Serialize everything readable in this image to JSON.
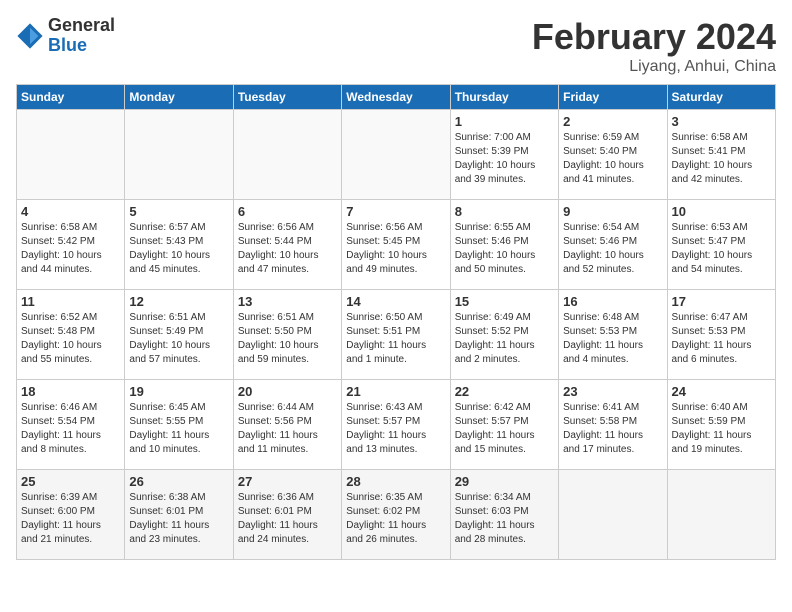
{
  "header": {
    "logo_general": "General",
    "logo_blue": "Blue",
    "title": "February 2024",
    "subtitle": "Liyang, Anhui, China"
  },
  "weekdays": [
    "Sunday",
    "Monday",
    "Tuesday",
    "Wednesday",
    "Thursday",
    "Friday",
    "Saturday"
  ],
  "weeks": [
    [
      {
        "day": "",
        "info": ""
      },
      {
        "day": "",
        "info": ""
      },
      {
        "day": "",
        "info": ""
      },
      {
        "day": "",
        "info": ""
      },
      {
        "day": "1",
        "info": "Sunrise: 7:00 AM\nSunset: 5:39 PM\nDaylight: 10 hours\nand 39 minutes."
      },
      {
        "day": "2",
        "info": "Sunrise: 6:59 AM\nSunset: 5:40 PM\nDaylight: 10 hours\nand 41 minutes."
      },
      {
        "day": "3",
        "info": "Sunrise: 6:58 AM\nSunset: 5:41 PM\nDaylight: 10 hours\nand 42 minutes."
      }
    ],
    [
      {
        "day": "4",
        "info": "Sunrise: 6:58 AM\nSunset: 5:42 PM\nDaylight: 10 hours\nand 44 minutes."
      },
      {
        "day": "5",
        "info": "Sunrise: 6:57 AM\nSunset: 5:43 PM\nDaylight: 10 hours\nand 45 minutes."
      },
      {
        "day": "6",
        "info": "Sunrise: 6:56 AM\nSunset: 5:44 PM\nDaylight: 10 hours\nand 47 minutes."
      },
      {
        "day": "7",
        "info": "Sunrise: 6:56 AM\nSunset: 5:45 PM\nDaylight: 10 hours\nand 49 minutes."
      },
      {
        "day": "8",
        "info": "Sunrise: 6:55 AM\nSunset: 5:46 PM\nDaylight: 10 hours\nand 50 minutes."
      },
      {
        "day": "9",
        "info": "Sunrise: 6:54 AM\nSunset: 5:46 PM\nDaylight: 10 hours\nand 52 minutes."
      },
      {
        "day": "10",
        "info": "Sunrise: 6:53 AM\nSunset: 5:47 PM\nDaylight: 10 hours\nand 54 minutes."
      }
    ],
    [
      {
        "day": "11",
        "info": "Sunrise: 6:52 AM\nSunset: 5:48 PM\nDaylight: 10 hours\nand 55 minutes."
      },
      {
        "day": "12",
        "info": "Sunrise: 6:51 AM\nSunset: 5:49 PM\nDaylight: 10 hours\nand 57 minutes."
      },
      {
        "day": "13",
        "info": "Sunrise: 6:51 AM\nSunset: 5:50 PM\nDaylight: 10 hours\nand 59 minutes."
      },
      {
        "day": "14",
        "info": "Sunrise: 6:50 AM\nSunset: 5:51 PM\nDaylight: 11 hours\nand 1 minute."
      },
      {
        "day": "15",
        "info": "Sunrise: 6:49 AM\nSunset: 5:52 PM\nDaylight: 11 hours\nand 2 minutes."
      },
      {
        "day": "16",
        "info": "Sunrise: 6:48 AM\nSunset: 5:53 PM\nDaylight: 11 hours\nand 4 minutes."
      },
      {
        "day": "17",
        "info": "Sunrise: 6:47 AM\nSunset: 5:53 PM\nDaylight: 11 hours\nand 6 minutes."
      }
    ],
    [
      {
        "day": "18",
        "info": "Sunrise: 6:46 AM\nSunset: 5:54 PM\nDaylight: 11 hours\nand 8 minutes."
      },
      {
        "day": "19",
        "info": "Sunrise: 6:45 AM\nSunset: 5:55 PM\nDaylight: 11 hours\nand 10 minutes."
      },
      {
        "day": "20",
        "info": "Sunrise: 6:44 AM\nSunset: 5:56 PM\nDaylight: 11 hours\nand 11 minutes."
      },
      {
        "day": "21",
        "info": "Sunrise: 6:43 AM\nSunset: 5:57 PM\nDaylight: 11 hours\nand 13 minutes."
      },
      {
        "day": "22",
        "info": "Sunrise: 6:42 AM\nSunset: 5:57 PM\nDaylight: 11 hours\nand 15 minutes."
      },
      {
        "day": "23",
        "info": "Sunrise: 6:41 AM\nSunset: 5:58 PM\nDaylight: 11 hours\nand 17 minutes."
      },
      {
        "day": "24",
        "info": "Sunrise: 6:40 AM\nSunset: 5:59 PM\nDaylight: 11 hours\nand 19 minutes."
      }
    ],
    [
      {
        "day": "25",
        "info": "Sunrise: 6:39 AM\nSunset: 6:00 PM\nDaylight: 11 hours\nand 21 minutes."
      },
      {
        "day": "26",
        "info": "Sunrise: 6:38 AM\nSunset: 6:01 PM\nDaylight: 11 hours\nand 23 minutes."
      },
      {
        "day": "27",
        "info": "Sunrise: 6:36 AM\nSunset: 6:01 PM\nDaylight: 11 hours\nand 24 minutes."
      },
      {
        "day": "28",
        "info": "Sunrise: 6:35 AM\nSunset: 6:02 PM\nDaylight: 11 hours\nand 26 minutes."
      },
      {
        "day": "29",
        "info": "Sunrise: 6:34 AM\nSunset: 6:03 PM\nDaylight: 11 hours\nand 28 minutes."
      },
      {
        "day": "",
        "info": ""
      },
      {
        "day": "",
        "info": ""
      }
    ]
  ]
}
